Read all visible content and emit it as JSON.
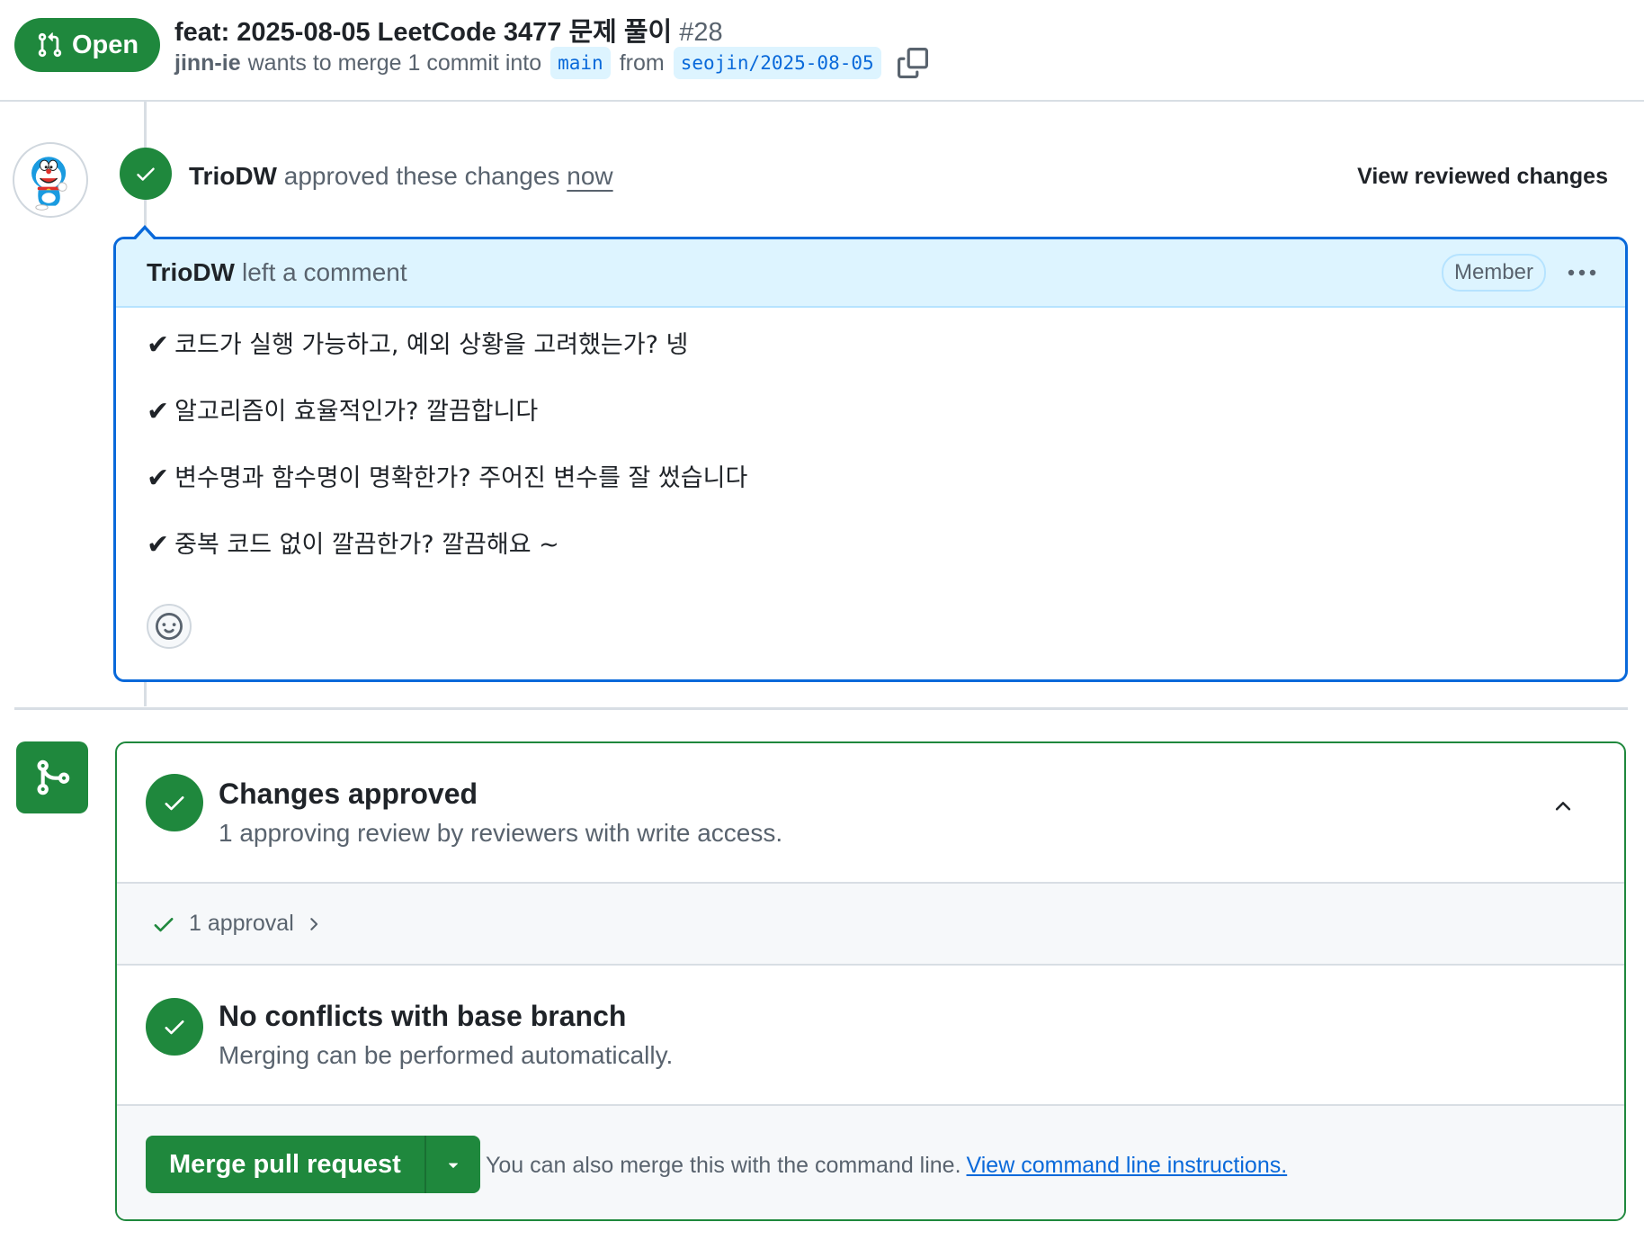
{
  "header": {
    "state": "Open",
    "title": "feat: 2025-08-05 LeetCode 3477 문제 풀이",
    "number": "#28",
    "author": "jinn-ie",
    "merge_text": "wants to merge 1 commit into",
    "base_branch": "main",
    "from_text": "from",
    "head_branch": "seojin/2025-08-05"
  },
  "review_event": {
    "actor": "TrioDW",
    "action": "approved these changes",
    "time": "now",
    "view_link": "View reviewed changes"
  },
  "comment": {
    "author": "TrioDW",
    "action": "left a comment",
    "role": "Member",
    "items": [
      "코드가 실행 가능하고, 예외 상황을 고려했는가? 넹",
      "알고리즘이 효율적인가? 깔끔합니다",
      "변수명과 함수명이 명확한가? 주어진 변수를 잘 썼습니다",
      "중복 코드 없이 깔끔한가? 깔끔해요 ~"
    ],
    "check_glyph": "✔"
  },
  "merge_box": {
    "approved_title": "Changes approved",
    "approved_desc": "1 approving review by reviewers with write access.",
    "approvals": "1 approval",
    "conflicts_title": "No conflicts with base branch",
    "conflicts_desc": "Merging can be performed automatically.",
    "merge_button": "Merge pull request",
    "note": "You can also merge this with the command line.",
    "note_link": "View command line instructions."
  },
  "colors": {
    "success": "#1f883d",
    "accent": "#0969da",
    "muted_text": "#59636e",
    "comment_header_bg": "#ddf4ff"
  },
  "icons": [
    "git-pull-request-icon",
    "copy-icon",
    "check-icon",
    "kebab-icon",
    "smiley-icon",
    "git-merge-icon",
    "chevron-up-icon",
    "chevron-right-icon",
    "triangle-down-icon",
    "avatar-doraemon"
  ]
}
